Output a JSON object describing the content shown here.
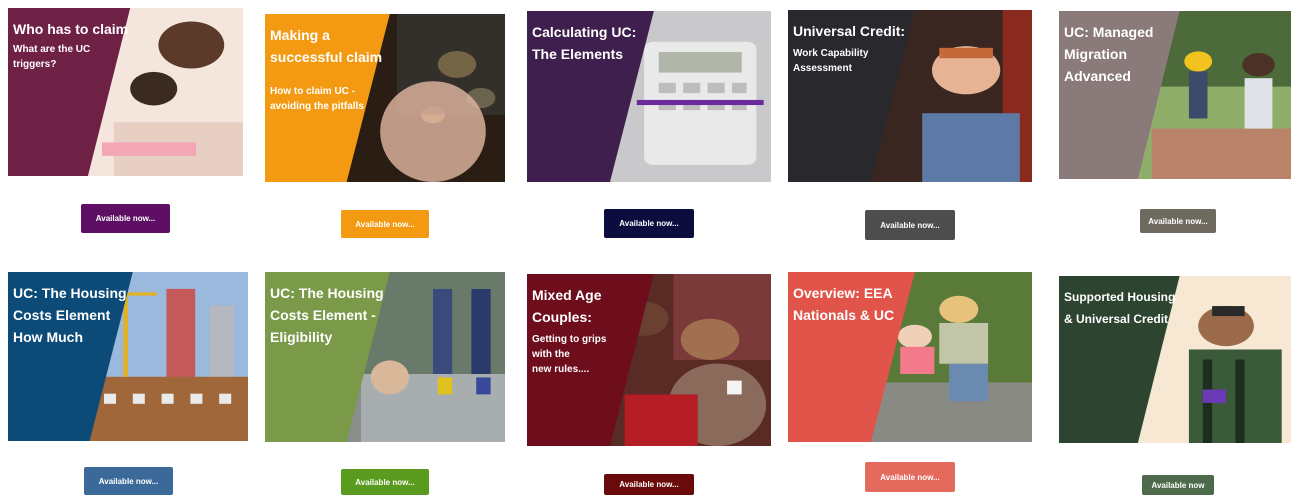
{
  "cards": [
    {
      "title": "Who has to claim",
      "subtitle": "What are the UC\ntriggers?",
      "color": "#6e2045",
      "button": "Available now...",
      "button_color": "#5f0f63"
    },
    {
      "title": "Making a\nsuccessful claim",
      "subtitle": "How to claim UC -\navoiding the pitfalls",
      "color": "#f39a12",
      "button": "Available now...",
      "button_color": "#f39a12"
    },
    {
      "title": "Calculating UC:\nThe Elements",
      "subtitle": "",
      "color": "#3e1f4d",
      "button": "Available now...",
      "button_color": "#0c0c3f"
    },
    {
      "title": "Universal Credit:",
      "subtitle": "Work Capability\nAssessment",
      "color": "#29282c",
      "button": "Available now...",
      "button_color": "#4d4d4d"
    },
    {
      "title": "UC: Managed\nMigration\nAdvanced",
      "subtitle": "",
      "color": "#8a7a79",
      "button": "Available now...",
      "button_color": "#6e6a60"
    },
    {
      "title": "UC: The Housing\nCosts Element\nHow Much",
      "subtitle": "",
      "color": "#0c4a78",
      "button": "Available now...",
      "button_color": "#3b6a9a"
    },
    {
      "title": "UC: The Housing\nCosts Element -\nEligibility",
      "subtitle": "",
      "color": "#7a9a4a",
      "button": "Available now...",
      "button_color": "#5a9a1e"
    },
    {
      "title": "Mixed Age\nCouples:",
      "subtitle": "Getting to grips\nwith the\nnew rules....",
      "color": "#6e0d1c",
      "button": "Available now...",
      "button_color": "#6a0a0a"
    },
    {
      "title": "Overview: EEA\nNationals & UC",
      "subtitle": "",
      "color": "#e0544a",
      "button": "Available now...",
      "button_color": "#e46a5e"
    },
    {
      "title": "Supported Housing\n& Universal Credit",
      "subtitle": "",
      "color": "#2d4430",
      "button": "Available now",
      "button_color": "#4d6a4a"
    }
  ]
}
